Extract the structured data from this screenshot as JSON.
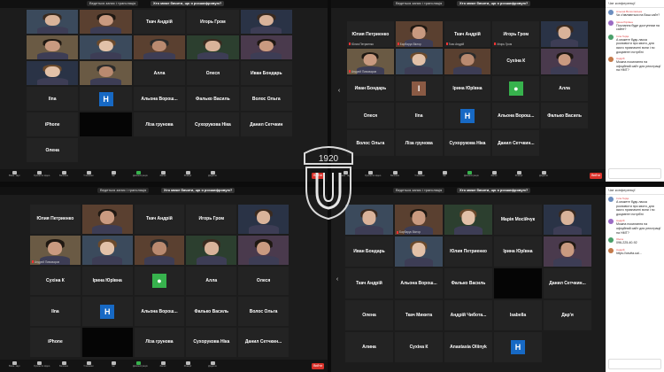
{
  "rec_label": "Ведеться запис і трансляція",
  "question": "Хто може бачити, що я розшифровую?",
  "end_label": "Вийти",
  "chat_title": "Чат конференції",
  "logo_year": "1920",
  "toolbar_labels": [
    "Вимк. звук",
    "Зупинити відео",
    "Безпека",
    "Учасники",
    "Чат",
    "Демонстрація",
    "Запис",
    "Реакції",
    "Додатки"
  ],
  "colors": {
    "accent": "#d8e34a",
    "end": "#d8322b",
    "avatar_blue": "#1769c4",
    "avatar_green": "#37b24d",
    "avatar_brown": "#8a5a44"
  },
  "tl": {
    "tiles": [
      {
        "name": "",
        "sub": "",
        "kind": "video"
      },
      {
        "name": "",
        "sub": "",
        "kind": "video"
      },
      {
        "name": "Ткач Андрій",
        "sub": "",
        "kind": "name"
      },
      {
        "name": "Игорь Гром",
        "sub": "",
        "kind": "name"
      },
      {
        "name": "",
        "sub": "",
        "kind": "video",
        "active": true
      },
      {
        "name": "",
        "sub": "",
        "kind": "video"
      },
      {
        "name": "",
        "sub": "",
        "kind": "video"
      },
      {
        "name": "",
        "sub": "",
        "kind": "video"
      },
      {
        "name": "",
        "sub": "",
        "kind": "video"
      },
      {
        "name": "",
        "sub": "",
        "kind": "video"
      },
      {
        "name": "",
        "sub": "",
        "kind": "video"
      },
      {
        "name": "",
        "sub": "",
        "kind": "video"
      },
      {
        "name": "Алла",
        "sub": "",
        "kind": "name"
      },
      {
        "name": "Олеся",
        "sub": "",
        "kind": "name"
      },
      {
        "name": "Иван Бондарь",
        "sub": "",
        "kind": "name"
      },
      {
        "name": "Ilna",
        "sub": "",
        "kind": "name"
      },
      {
        "name": "",
        "sub": "",
        "kind": "avatar",
        "letter": "H",
        "color": "#1769c4"
      },
      {
        "name": "Альона Ворош...",
        "sub": "",
        "kind": "name"
      },
      {
        "name": "Фалько Василь",
        "sub": "",
        "kind": "name"
      },
      {
        "name": "Волос Ольга",
        "sub": "",
        "kind": "name"
      },
      {
        "name": "iPhone",
        "sub": "",
        "kind": "name"
      },
      {
        "name": "",
        "sub": "",
        "kind": "black"
      },
      {
        "name": "Ліза грунова",
        "sub": "",
        "kind": "name"
      },
      {
        "name": "Сухорукова Ніка",
        "sub": "",
        "kind": "name"
      },
      {
        "name": "Данил Сетчкин",
        "sub": "",
        "kind": "name"
      },
      {
        "name": "Олена",
        "sub": "",
        "kind": "name"
      }
    ]
  },
  "tr": {
    "tiles": [
      {
        "name": "Юлия Петриенко",
        "sub": "Юлия Петриенко",
        "kind": "name"
      },
      {
        "name": "",
        "sub": "Барбарук Віктор",
        "kind": "video"
      },
      {
        "name": "Ткач Андрій",
        "sub": "Ткач Андрій",
        "kind": "name"
      },
      {
        "name": "Игорь Гром",
        "sub": "Игорь Гром",
        "kind": "name"
      },
      {
        "name": "",
        "sub": "",
        "kind": "video"
      },
      {
        "name": "",
        "sub": "Андрей Пивоваров",
        "kind": "video",
        "active": true
      },
      {
        "name": "",
        "sub": "",
        "kind": "video"
      },
      {
        "name": "",
        "sub": "",
        "kind": "video"
      },
      {
        "name": "Сухіна К",
        "sub": "",
        "kind": "name"
      },
      {
        "name": "",
        "sub": "",
        "kind": "video"
      },
      {
        "name": "Иван Бондарь",
        "sub": "",
        "kind": "name"
      },
      {
        "name": "",
        "sub": "",
        "kind": "avatar",
        "letter": "I",
        "color": "#8a5a44"
      },
      {
        "name": "Ірина Юрївна",
        "sub": "",
        "kind": "name"
      },
      {
        "name": "",
        "sub": "",
        "kind": "avatar",
        "letter": "●",
        "color": "#37b24d"
      },
      {
        "name": "Алла",
        "sub": "",
        "kind": "name"
      },
      {
        "name": "Олеся",
        "sub": "",
        "kind": "name"
      },
      {
        "name": "Ilna",
        "sub": "",
        "kind": "name"
      },
      {
        "name": "",
        "sub": "",
        "kind": "avatar",
        "letter": "H",
        "color": "#1769c4"
      },
      {
        "name": "Альона Ворош...",
        "sub": "",
        "kind": "name"
      },
      {
        "name": "Фалько Василь",
        "sub": "",
        "kind": "name"
      },
      {
        "name": "Волос Ольга",
        "sub": "",
        "kind": "name"
      },
      {
        "name": "Ліза грунова",
        "sub": "",
        "kind": "name"
      },
      {
        "name": "Сухорукова Ніка",
        "sub": "",
        "kind": "name"
      },
      {
        "name": "Данил Сетчкин...",
        "sub": "",
        "kind": "name"
      }
    ]
  },
  "bl": {
    "tiles": [
      {
        "name": "Юлия Петриенко",
        "sub": "",
        "kind": "name"
      },
      {
        "name": "",
        "sub": "",
        "kind": "video"
      },
      {
        "name": "Ткач Андрій",
        "sub": "",
        "kind": "name"
      },
      {
        "name": "Игорь Гром",
        "sub": "",
        "kind": "name"
      },
      {
        "name": "",
        "sub": "",
        "kind": "video"
      },
      {
        "name": "",
        "sub": "Андрей Пивоваров",
        "kind": "video",
        "active": true
      },
      {
        "name": "",
        "sub": "",
        "kind": "video"
      },
      {
        "name": "",
        "sub": "",
        "kind": "video"
      },
      {
        "name": "",
        "sub": "",
        "kind": "video"
      },
      {
        "name": "",
        "sub": "",
        "kind": "video"
      },
      {
        "name": "Сухіна К",
        "sub": "",
        "kind": "name"
      },
      {
        "name": "Ірина Юрївна",
        "sub": "",
        "kind": "name"
      },
      {
        "name": "",
        "sub": "",
        "kind": "avatar",
        "letter": "●",
        "color": "#37b24d"
      },
      {
        "name": "Алла",
        "sub": "",
        "kind": "name"
      },
      {
        "name": "Олеся",
        "sub": "",
        "kind": "name"
      },
      {
        "name": "Ilna",
        "sub": "",
        "kind": "name"
      },
      {
        "name": "",
        "sub": "",
        "kind": "avatar",
        "letter": "H",
        "color": "#1769c4"
      },
      {
        "name": "Альона Ворош...",
        "sub": "",
        "kind": "name"
      },
      {
        "name": "Фалько Василь",
        "sub": "",
        "kind": "name"
      },
      {
        "name": "Волос Ольга",
        "sub": "",
        "kind": "name"
      },
      {
        "name": "iPhone",
        "sub": "",
        "kind": "name"
      },
      {
        "name": "",
        "sub": "",
        "kind": "black"
      },
      {
        "name": "Ліза грунова",
        "sub": "",
        "kind": "name"
      },
      {
        "name": "Сухорукова Ніка",
        "sub": "",
        "kind": "name"
      },
      {
        "name": "Данил Сетчкин...",
        "sub": "",
        "kind": "name"
      }
    ]
  },
  "br": {
    "tiles": [
      {
        "name": "",
        "sub": "",
        "kind": "video",
        "active": true
      },
      {
        "name": "",
        "sub": "Барбарук Віктор",
        "kind": "video"
      },
      {
        "name": "",
        "sub": "",
        "kind": "video"
      },
      {
        "name": "Марія Мосійчук",
        "sub": "",
        "kind": "name"
      },
      {
        "name": "",
        "sub": "",
        "kind": "video"
      },
      {
        "name": "Иван Бондарь",
        "sub": "",
        "kind": "name"
      },
      {
        "name": "",
        "sub": "",
        "kind": "video"
      },
      {
        "name": "Юлия Петриенко",
        "sub": "",
        "kind": "name"
      },
      {
        "name": "Ірина Юрївна",
        "sub": "",
        "kind": "name"
      },
      {
        "name": "",
        "sub": "",
        "kind": "video"
      },
      {
        "name": "Ткач Андрій",
        "sub": "",
        "kind": "name"
      },
      {
        "name": "Альона Ворош...",
        "sub": "",
        "kind": "name"
      },
      {
        "name": "Фалько Василь",
        "sub": "",
        "kind": "name"
      },
      {
        "name": "",
        "sub": "",
        "kind": "black"
      },
      {
        "name": "Данил Сетчкин...",
        "sub": "",
        "kind": "name"
      },
      {
        "name": "Олена",
        "sub": "",
        "kind": "name"
      },
      {
        "name": "Ткач Микита",
        "sub": "",
        "kind": "name"
      },
      {
        "name": "Андрій Чибота...",
        "sub": "",
        "kind": "name"
      },
      {
        "name": "Isabella",
        "sub": "",
        "kind": "name"
      },
      {
        "name": "Дар'я",
        "sub": "",
        "kind": "name"
      },
      {
        "name": "Алина",
        "sub": "",
        "kind": "name"
      },
      {
        "name": "Сухіна К",
        "sub": "",
        "kind": "name"
      },
      {
        "name": "Anastasia Oliinyk",
        "sub": "",
        "kind": "name"
      },
      {
        "name": "",
        "sub": "",
        "kind": "avatar",
        "letter": "H",
        "color": "#1769c4"
      }
    ]
  },
  "chat_tr": [
    {
      "who": "Альона Волосовська",
      "txt": "Чи з'являються на Ваш сайт?"
    },
    {
      "who": "Ірина Юрївна",
      "txt": "Послання буде доступним на сайте?"
    },
    {
      "who": "Ілла Гніда",
      "txt": "А можете будь ласка розповісти про квоти, для якого призначені вони і по документі потрібні"
    },
    {
      "who": "Андрій",
      "txt": "Можна посилання на офіційний сайт для реєстрації на НМТ?"
    }
  ],
  "chat_br": [
    {
      "who": "Ілла Гніда",
      "txt": "А можете будь ласка розповісти про квоти, для якого призначені вони і по документі потрібні"
    },
    {
      "who": "Андрій",
      "txt": "Можна посилання на офіційний сайт для реєстрації на НМТ?"
    },
    {
      "who": "Olena",
      "txt": "096-225-40-92"
    },
    {
      "who": "Андрій",
      "txt": "https://osvita.ua/..."
    }
  ]
}
